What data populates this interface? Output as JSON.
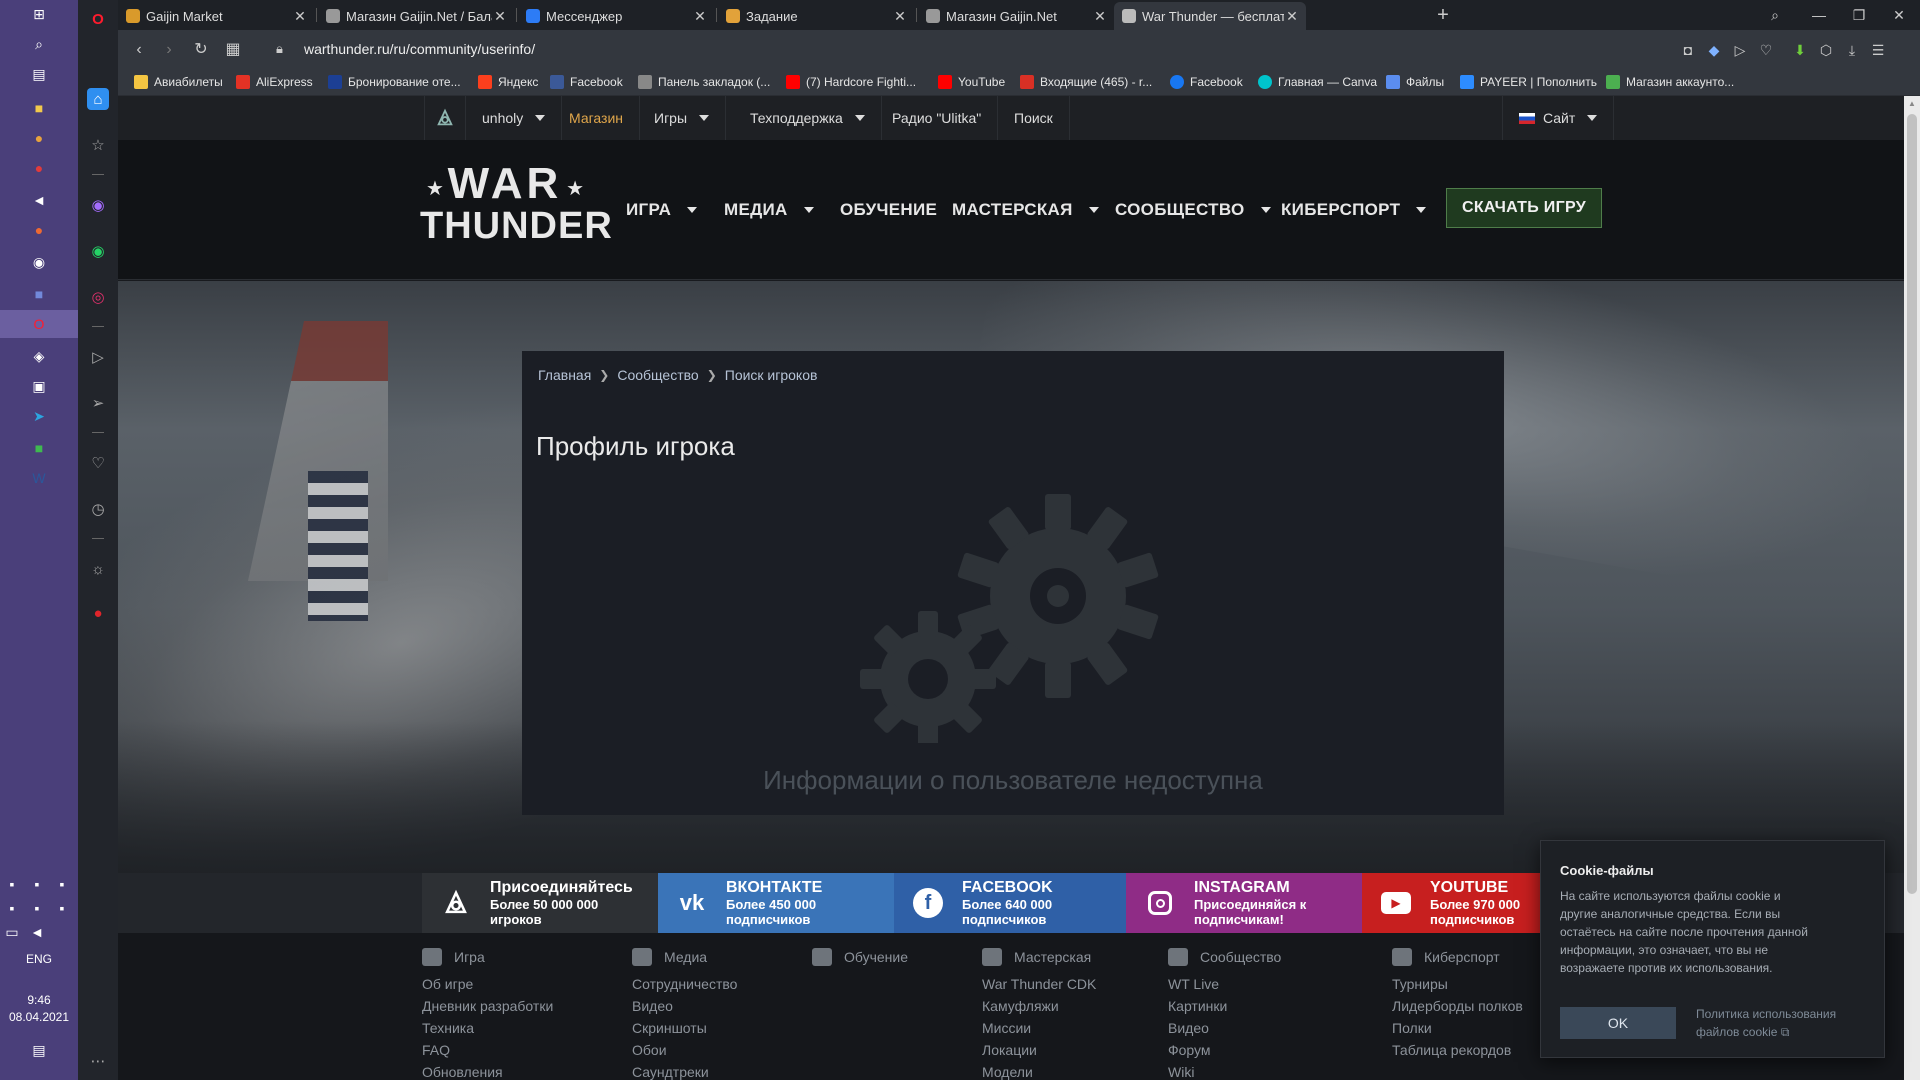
{
  "browser": {
    "tabs": [
      {
        "label": "Gaijin Market",
        "color": "#d99a2b"
      },
      {
        "label": "Магазин Gaijin.Net / Балан",
        "color": "#cccccc"
      },
      {
        "label": "Мессенджер",
        "color": "#2d7cf6"
      },
      {
        "label": "Задание",
        "color": "#e2a23a"
      },
      {
        "label": "Магазин Gaijin.Net",
        "color": "#cccccc"
      },
      {
        "label": "War Thunder — бесплатна",
        "color": "#cccccc"
      }
    ],
    "url": "warthunder.ru/ru/community/userinfo/",
    "bookmarks": [
      {
        "label": "Авиабилеты",
        "color": "#f4c542"
      },
      {
        "label": "AliExpress",
        "color": "#e43225"
      },
      {
        "label": "Бронирование оте...",
        "color": "#1c3f94"
      },
      {
        "label": "Яндекс",
        "color": "#fc3f1d"
      },
      {
        "label": "Facebook",
        "color": "#3b5998"
      },
      {
        "label": "Панель закладок (...",
        "color": "#888888"
      },
      {
        "label": "(7) Hardcore Fighti...",
        "color": "#ff0000"
      },
      {
        "label": "YouTube",
        "color": "#ff0000"
      },
      {
        "label": "Входящие (465) - r...",
        "color": "#d93025"
      },
      {
        "label": "Facebook",
        "color": "#1877f2"
      },
      {
        "label": "Главная — Canva",
        "color": "#00c4cc"
      },
      {
        "label": "Файлы",
        "color": "#5b8def"
      },
      {
        "label": "PAYEER | Пополнить",
        "color": "#2d8cff"
      },
      {
        "label": "Магазин аккаунто...",
        "color": "#4caf50"
      }
    ]
  },
  "taskbar": {
    "lang": "ENG",
    "time": "9:46",
    "date": "08.04.2021"
  },
  "gaijin_bar": {
    "user": "unholy",
    "shop": "Магазин",
    "games": "Игры",
    "support": "Техподдержка",
    "radio": "Радио \"Ulitka\"",
    "search": "Поиск",
    "site": "Сайт"
  },
  "header": {
    "logo_top": "WAR",
    "logo_bottom": "THUNDER",
    "nav": [
      "ИГРА",
      "МЕДИА",
      "ОБУЧЕНИЕ",
      "МАСТЕРСКАЯ",
      "СООБЩЕСТВО",
      "КИБЕРСПОРТ"
    ],
    "download": "СКАЧАТЬ ИГРУ"
  },
  "breadcrumb": [
    "Главная",
    "Сообщество",
    "Поиск игроков"
  ],
  "page_title": "Профиль игрока",
  "unavailable": "Информации о пользователе недоступна",
  "social": [
    {
      "title": "Присоединяйтесь",
      "sub1": "Более 50 000 000",
      "sub2": "игроков",
      "color": "#2d3034"
    },
    {
      "title": "ВКОНТАКТЕ",
      "sub1": "Более 450 000",
      "sub2": "подписчиков",
      "color": "#3a74b8"
    },
    {
      "title": "FACEBOOK",
      "sub1": "Более 640 000",
      "sub2": "подписчиков",
      "color": "#2f60a7"
    },
    {
      "title": "INSTAGRAM",
      "sub1": "Присоединяйся к",
      "sub2": "подписчикам!",
      "color": "#8f2c86"
    },
    {
      "title": "YOUTUBE",
      "sub1": "Более 970 000",
      "sub2": "подписчиков",
      "color": "#c71f1f"
    }
  ],
  "footer": [
    {
      "title": "Игра",
      "links": [
        "Об игре",
        "Дневник разработки",
        "Техника",
        "FAQ",
        "Обновления"
      ]
    },
    {
      "title": "Медиа",
      "links": [
        "Сотрудничество",
        "Видео",
        "Скриншоты",
        "Обои",
        "Саундтреки"
      ]
    },
    {
      "title": "Обучение",
      "links": []
    },
    {
      "title": "Мастерская",
      "links": [
        "War Thunder CDK",
        "Камуфляжи",
        "Миссии",
        "Локации",
        "Модели"
      ]
    },
    {
      "title": "Сообщество",
      "links": [
        "WT Live",
        "Картинки",
        "Видео",
        "Форум",
        "Wiki"
      ]
    },
    {
      "title": "Киберспорт",
      "links": [
        "Турниры",
        "Лидерборды полков",
        "Полки",
        "Таблица рекордов"
      ]
    }
  ],
  "cookie": {
    "title": "Cookie-файлы",
    "text": "На сайте используются файлы cookie и другие аналогичные средства. Если вы остаётесь на сайте после прочтения данной информации, это означает, что вы не возражаете против их использования.",
    "ok": "OK",
    "policy": "Политика использования файлов cookie"
  }
}
